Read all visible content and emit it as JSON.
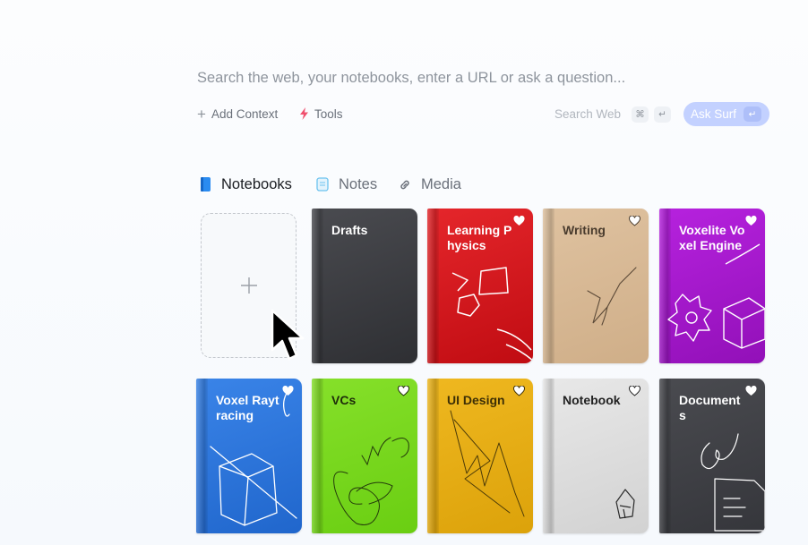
{
  "search": {
    "placeholder": "Search the web, your notebooks, enter a URL or ask a question..."
  },
  "toolbar": {
    "add_context_label": "Add Context",
    "tools_label": "Tools",
    "search_web_label": "Search Web",
    "cmd_key": "⌘",
    "enter_key": "↵",
    "ask_label": "Ask Surf"
  },
  "tabs": [
    {
      "label": "Notebooks",
      "active": true,
      "icon": "notebook-icon"
    },
    {
      "label": "Notes",
      "active": false,
      "icon": "note-icon"
    },
    {
      "label": "Media",
      "active": false,
      "icon": "link-icon"
    }
  ],
  "colors": {
    "accent": "#c3d1ff",
    "tools_icon": "#f0506e"
  },
  "notebooks": [
    {
      "title": "Drafts",
      "color": "#3c3d42",
      "favorite": false,
      "icon": "none"
    },
    {
      "title": "Learning Physics",
      "color": "#d8171b",
      "favorite": true,
      "icon": "shapes-doodle"
    },
    {
      "title": "Writing",
      "color": "#d8b893",
      "favorite": true,
      "icon": "pen-doodle"
    },
    {
      "title": "Voxelite Voxel Engine",
      "color": "#a315c9",
      "favorite": true,
      "icon": "cube-doodle"
    },
    {
      "title": "Voxel Raytracing",
      "color": "#2f78dd",
      "favorite": true,
      "icon": "box-doodle"
    },
    {
      "title": "VCs",
      "color": "#78dc1a",
      "favorite": true,
      "icon": "scribble-doodle"
    },
    {
      "title": "UI Design",
      "color": "#e6ab11",
      "favorite": true,
      "icon": "zigzag-doodle"
    },
    {
      "title": "Notebook",
      "color": "#dedede",
      "favorite": true,
      "icon": "house-doodle"
    },
    {
      "title": "Documents",
      "color": "#404146",
      "favorite": true,
      "icon": "document-doodle"
    }
  ]
}
